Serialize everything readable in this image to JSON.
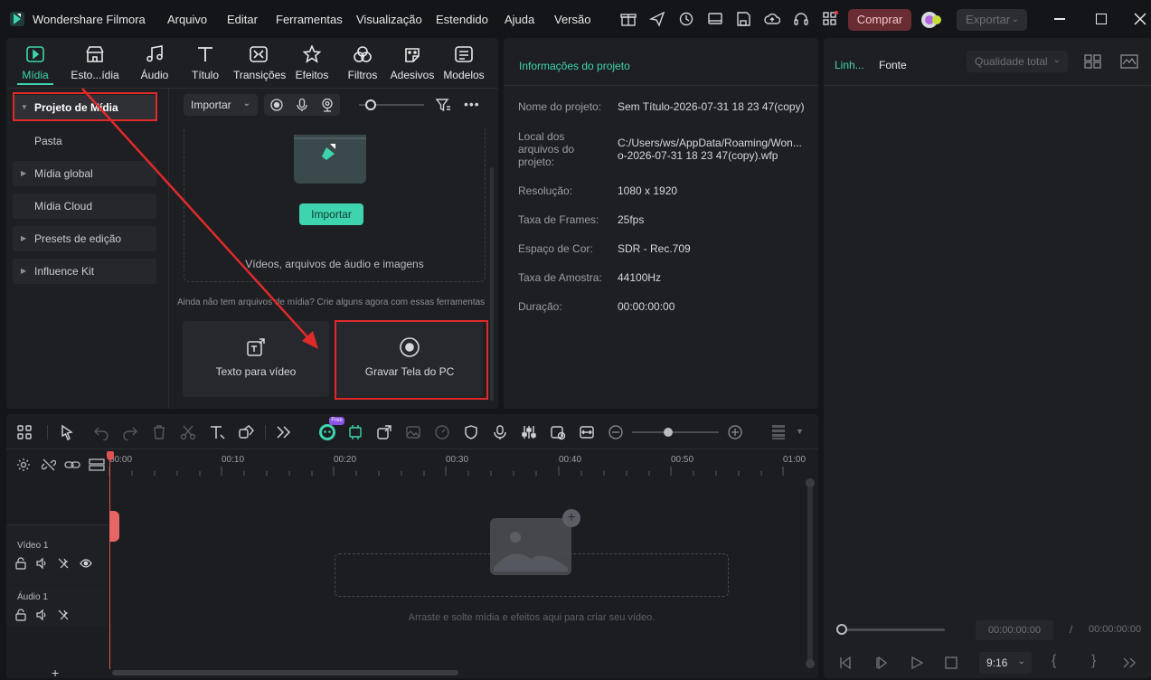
{
  "app": {
    "name": "Wondershare Filmora"
  },
  "menu": [
    "Arquivo",
    "Editar",
    "Ferramentas",
    "Visualização",
    "Estendido",
    "Ajuda",
    "Versão"
  ],
  "toolbar": {
    "buy_label": "Comprar",
    "export_label": "Exportar"
  },
  "media_tabs": [
    "Mídia",
    "Esto...ídia",
    "Áudio",
    "Título",
    "Transições",
    "Efeitos",
    "Filtros",
    "Adesivos",
    "Modelos"
  ],
  "sidebar": {
    "items": [
      {
        "label": "Projeto de Mídia"
      },
      {
        "label": "Pasta"
      },
      {
        "label": "Mídia global"
      },
      {
        "label": "Mídia Cloud"
      },
      {
        "label": "Presets de edição"
      },
      {
        "label": "Influence Kit"
      }
    ]
  },
  "media": {
    "import_dropdown": "Importar",
    "import_button": "Importar",
    "drop_hint": "Vídeos, arquivos de áudio e imagens",
    "no_media_hint": "Ainda não tem arquivos de mídia? Crie alguns agora com essas ferramentas",
    "cards": [
      {
        "label": "Texto para vídeo"
      },
      {
        "label": "Gravar Tela do PC"
      }
    ]
  },
  "project_info": {
    "title": "Informações do projeto",
    "rows": [
      {
        "label": "Nome do projeto:",
        "value": "Sem Título-2026-07-31 18 23 47(copy)"
      },
      {
        "label": "Local dos arquivos do projeto:",
        "value": "C:/Users/ws/AppData/Roaming/Won... o-2026-07-31 18 23 47(copy).wfp"
      },
      {
        "label": "Resolução:",
        "value": "1080 x 1920"
      },
      {
        "label": "Taxa de Frames:",
        "value": "25fps"
      },
      {
        "label": "Espaço de Cor:",
        "value": "SDR - Rec.709"
      },
      {
        "label": "Taxa de Amostra:",
        "value": "44100Hz"
      },
      {
        "label": "Duração:",
        "value": "00:00:00:00"
      }
    ]
  },
  "preview": {
    "tab_timeline": "Linh...",
    "tab_source": "Fonte",
    "quality": "Qualidade total",
    "time_current": "00:00:00:00",
    "time_sep": "/",
    "time_total": "00:00:00:00",
    "aspect": "9:16"
  },
  "timeline": {
    "free_badge": "Free",
    "ruler": [
      "00:00",
      "00:10",
      "00:20",
      "00:30",
      "00:40",
      "00:50",
      "01:00"
    ],
    "tracks": [
      "Vídeo 1",
      "Áudio 1"
    ],
    "drop_hint": "Arraste e solte mídia e efeitos aqui para criar seu vídeo."
  },
  "colors": {
    "accent": "#3ed5ae",
    "highlight": "#e02a2a",
    "buy": "#6a2c33"
  }
}
